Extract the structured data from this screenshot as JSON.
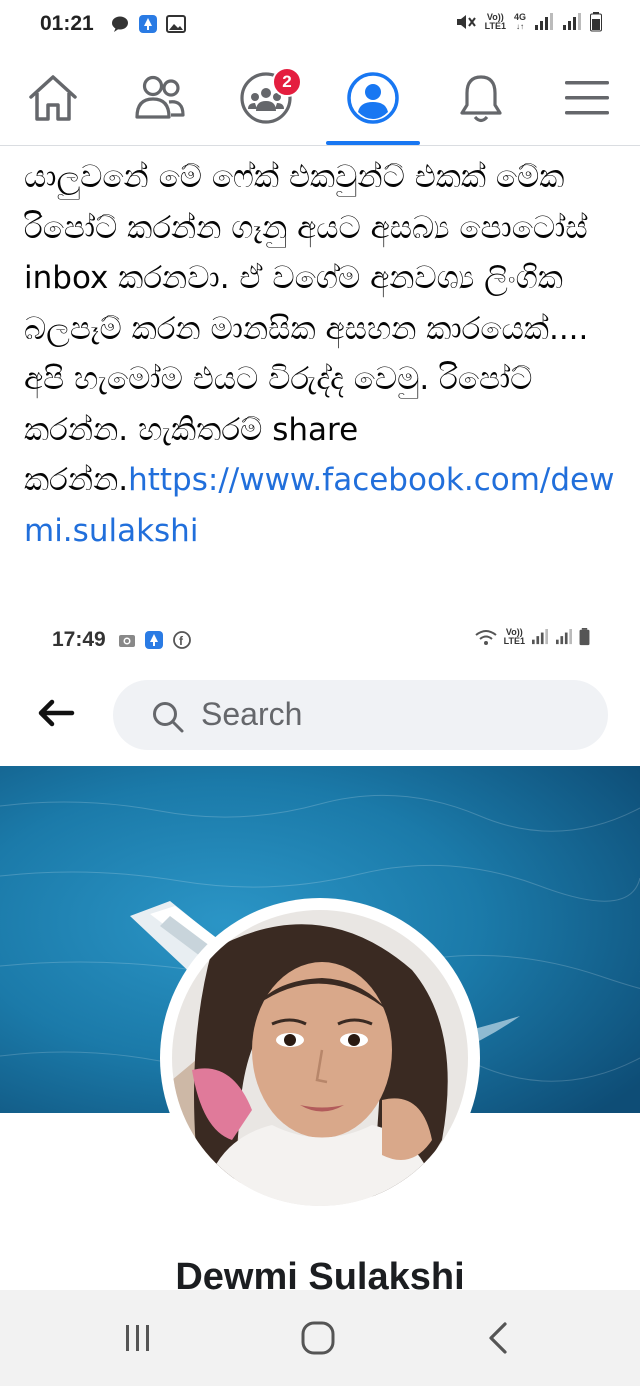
{
  "status_bar": {
    "time": "01:21",
    "volte_label": "Vo))",
    "lte_label": "LTE1",
    "network_label": "4G",
    "icons": [
      "chat-bubble-icon",
      "upload-app-icon",
      "image-icon",
      "mute-icon",
      "signal-icon",
      "signal-icon",
      "battery-icon"
    ]
  },
  "nav": {
    "items": [
      {
        "name": "home",
        "icon": "home-icon"
      },
      {
        "name": "friends",
        "icon": "friends-icon"
      },
      {
        "name": "groups",
        "icon": "groups-icon",
        "badge": "2"
      },
      {
        "name": "profile",
        "icon": "profile-icon",
        "active": true
      },
      {
        "name": "notifications",
        "icon": "bell-icon"
      },
      {
        "name": "menu",
        "icon": "hamburger-menu-icon"
      }
    ],
    "accent_color": "#1877f2",
    "badge_color": "#e41e3f"
  },
  "post": {
    "text": "යාලුවනේ මේ ෆේක් එකවුන්ට් එකක් මේක රිපෝට් කරන්න ගෑනු අයට අසබ්‍ය පොටෝස් inbox කරනවා. ඒ වගේම අනවශ්‍ය ලිංගික බලපෑම් කරන මානසික අසහන කාරයෙක්.... අපි හැමෝම එයට විරුද්ද වෙමු. රිපෝට් කරන්න. හැකිතරම් share කරන්න.",
    "link": "https://www.facebook.com/dewmi.sulakshi",
    "link_color": "#216fdb"
  },
  "embedded_screenshot": {
    "status_time": "17:49",
    "volte_label": "Vo))",
    "lte_label": "LTE1",
    "search_placeholder": "Search",
    "profile_name": "Dewmi Sulakshi"
  },
  "android_nav": {
    "buttons": [
      "recent-apps-icon",
      "home-circle-icon",
      "back-chevron-icon"
    ]
  }
}
